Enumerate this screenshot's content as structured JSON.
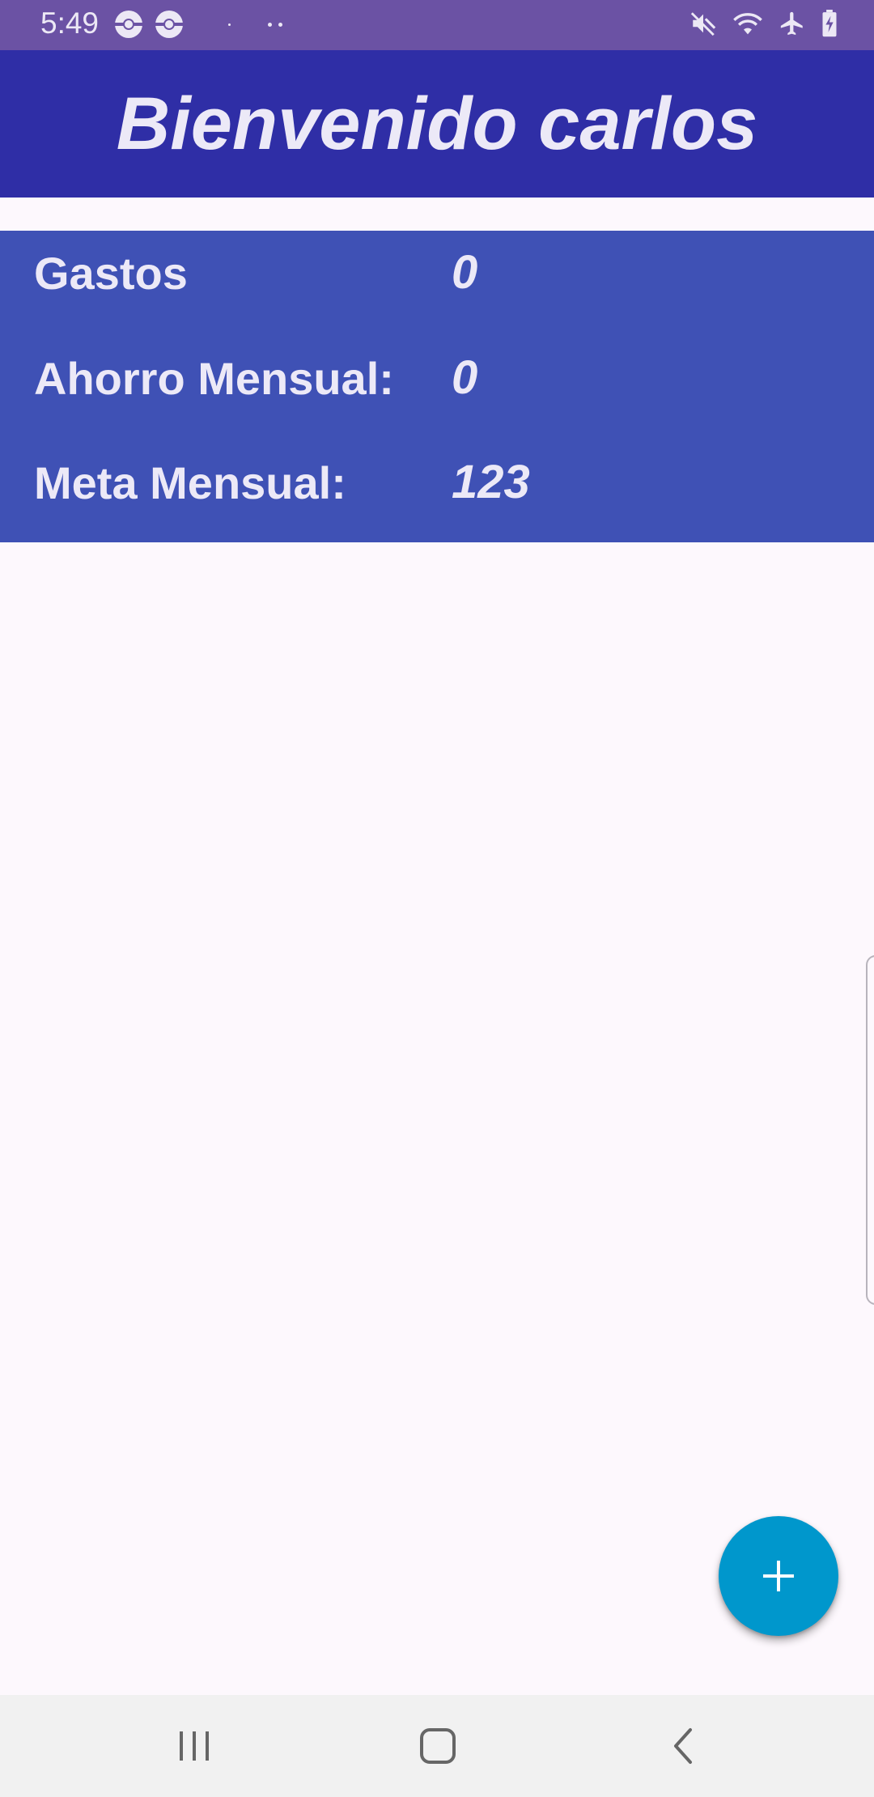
{
  "status_bar": {
    "time": "5:49",
    "icons_left": [
      "pokeball-icon",
      "pokeball-icon",
      "dot-icon",
      "more-dots-icon"
    ],
    "icons_right": [
      "mute-icon",
      "wifi-icon",
      "airplane-mode-icon",
      "battery-charging-icon"
    ]
  },
  "app_bar": {
    "title": "Bienvenido carlos"
  },
  "summary": {
    "rows": [
      {
        "label": "Gastos",
        "value": "0"
      },
      {
        "label": "Ahorro Mensual:",
        "value": "0"
      },
      {
        "label": "Meta Mensual:",
        "value": "123"
      }
    ]
  },
  "fab": {
    "icon": "plus-icon",
    "label": "+"
  },
  "nav_bar": {
    "buttons": [
      "recent-apps-icon",
      "home-icon",
      "back-icon"
    ]
  },
  "colors": {
    "status_bar": "#6b52a4",
    "app_bar": "#2f2ea6",
    "summary_card": "#3f51b5",
    "fab": "#0097cc",
    "background": "#fdf8fd",
    "nav_bar": "#f1f1f1"
  }
}
